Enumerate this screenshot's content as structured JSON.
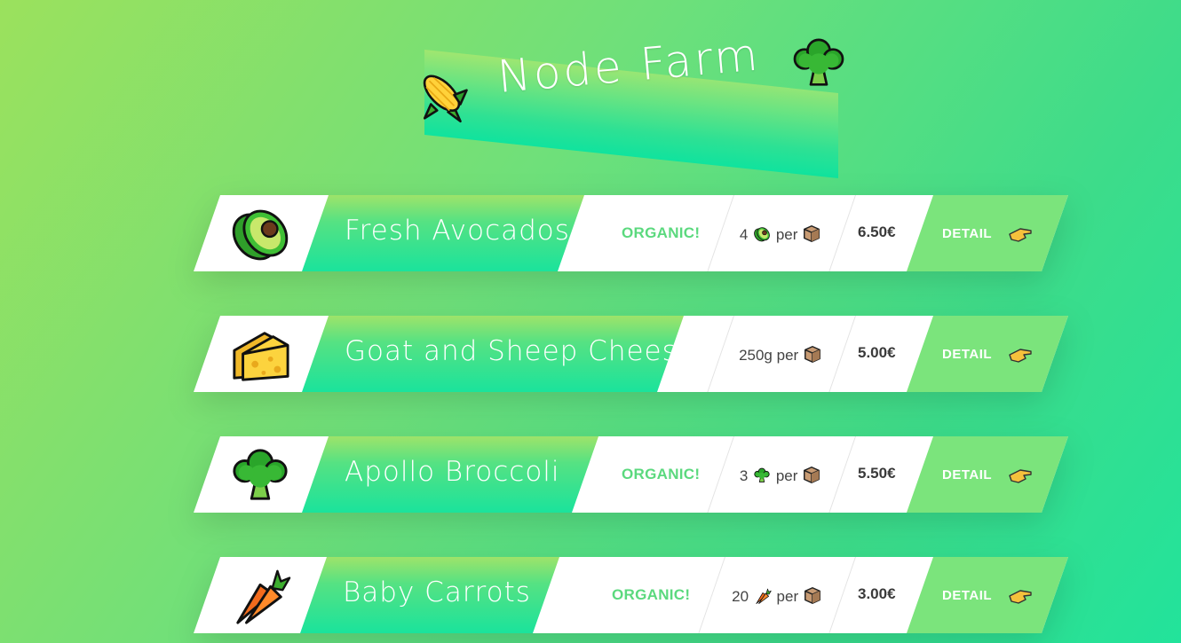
{
  "header": {
    "title": "Node Farm",
    "left_icon": "corn-icon",
    "right_icon": "broccoli-icon"
  },
  "products": [
    {
      "name": "Fresh Avocados",
      "icon": "avocado-icon",
      "organic_label": "ORGANIC!",
      "qty_amount": "4",
      "qty_icon": "avocado-icon",
      "per_label": "per",
      "price": "6.50€",
      "detail_label": "DETAIL"
    },
    {
      "name": "Goat and Sheep Cheese",
      "icon": "cheese-icon",
      "organic_label": "",
      "qty_amount": "250g",
      "qty_icon": "",
      "per_label": "per",
      "price": "5.00€",
      "detail_label": "DETAIL"
    },
    {
      "name": "Apollo Broccoli",
      "icon": "broccoli-icon",
      "organic_label": "ORGANIC!",
      "qty_amount": "3",
      "qty_icon": "broccoli-icon",
      "per_label": "per",
      "price": "5.50€",
      "detail_label": "DETAIL"
    },
    {
      "name": "Baby Carrots",
      "icon": "carrot-icon",
      "organic_label": "ORGANIC!",
      "qty_amount": "20",
      "qty_icon": "carrot-icon",
      "per_label": "per",
      "price": "3.00€",
      "detail_label": "DETAIL"
    }
  ],
  "colors": {
    "accent_green": "#5bd97e",
    "detail_bg": "#7be47c",
    "band_top": "#9ee36a",
    "band_bottom": "#1ae39c"
  }
}
